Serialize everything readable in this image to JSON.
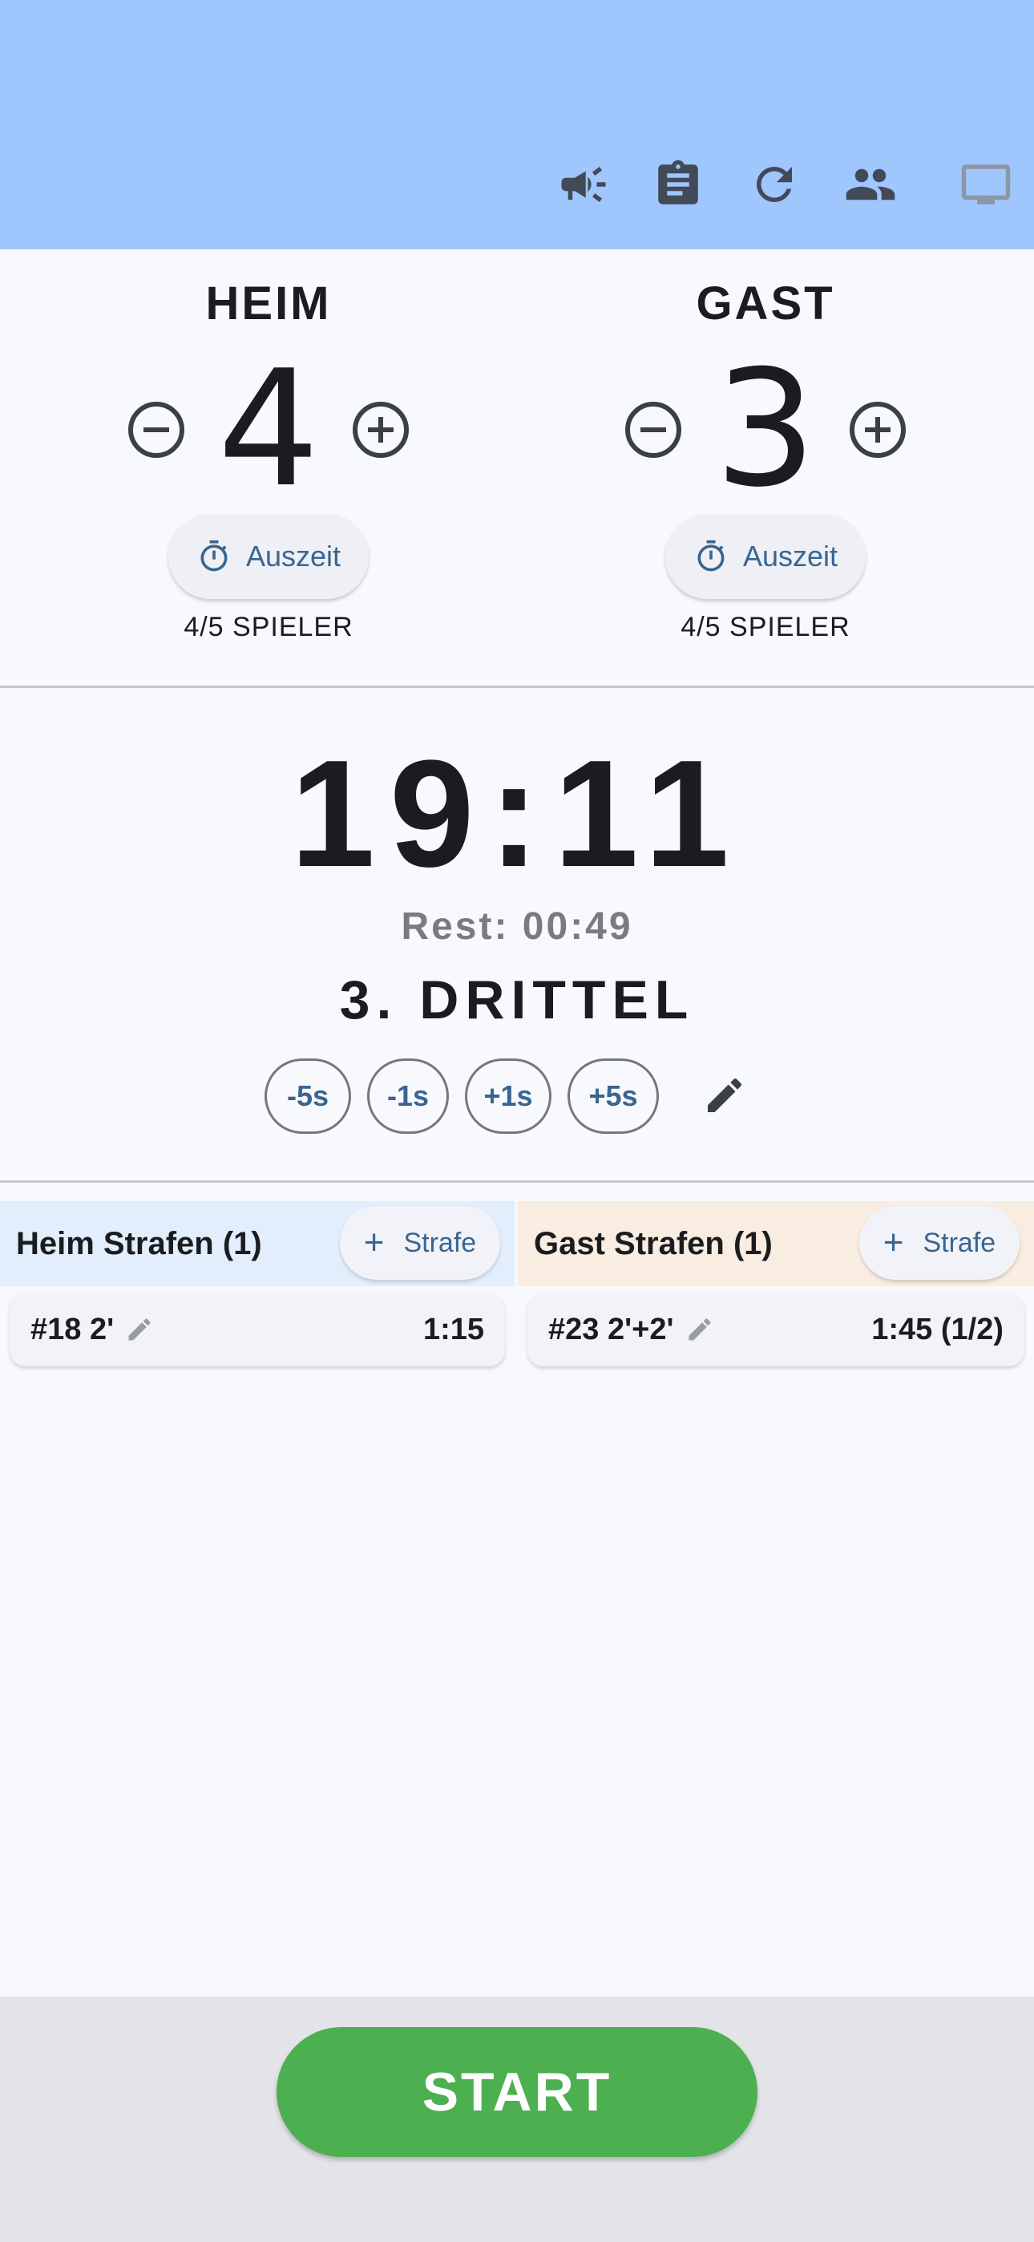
{
  "appbar": {
    "actions": [
      "announcement-icon",
      "clipboard-icon",
      "refresh-icon",
      "people-icon",
      "monitor-icon"
    ]
  },
  "home": {
    "name": "HEIM",
    "score": "4",
    "timeout_label": "Auszeit",
    "players": "4/5 SPIELER"
  },
  "away": {
    "name": "GAST",
    "score": "3",
    "timeout_label": "Auszeit",
    "players": "4/5 SPIELER"
  },
  "clock": {
    "time": "19:11",
    "rest": "Rest: 00:49",
    "period": "3. DRITTEL",
    "adjust": [
      "-5s",
      "-1s",
      "+1s",
      "+5s"
    ]
  },
  "penalties": {
    "home": {
      "title": "Heim Strafen (1)",
      "add_label": "Strafe",
      "items": [
        {
          "label": "#18 2'",
          "time": "1:15"
        }
      ]
    },
    "away": {
      "title": "Gast Strafen (1)",
      "add_label": "Strafe",
      "items": [
        {
          "label": "#23 2'+2'",
          "time": "1:45 (1/2)"
        }
      ]
    }
  },
  "footer": {
    "start_label": "START"
  },
  "colors": {
    "appbar": "#9fc6fd",
    "accent": "#3a6591",
    "start": "#4caf50",
    "home_penalty_bg": "#e2eefc",
    "away_penalty_bg": "#f9ece1"
  }
}
